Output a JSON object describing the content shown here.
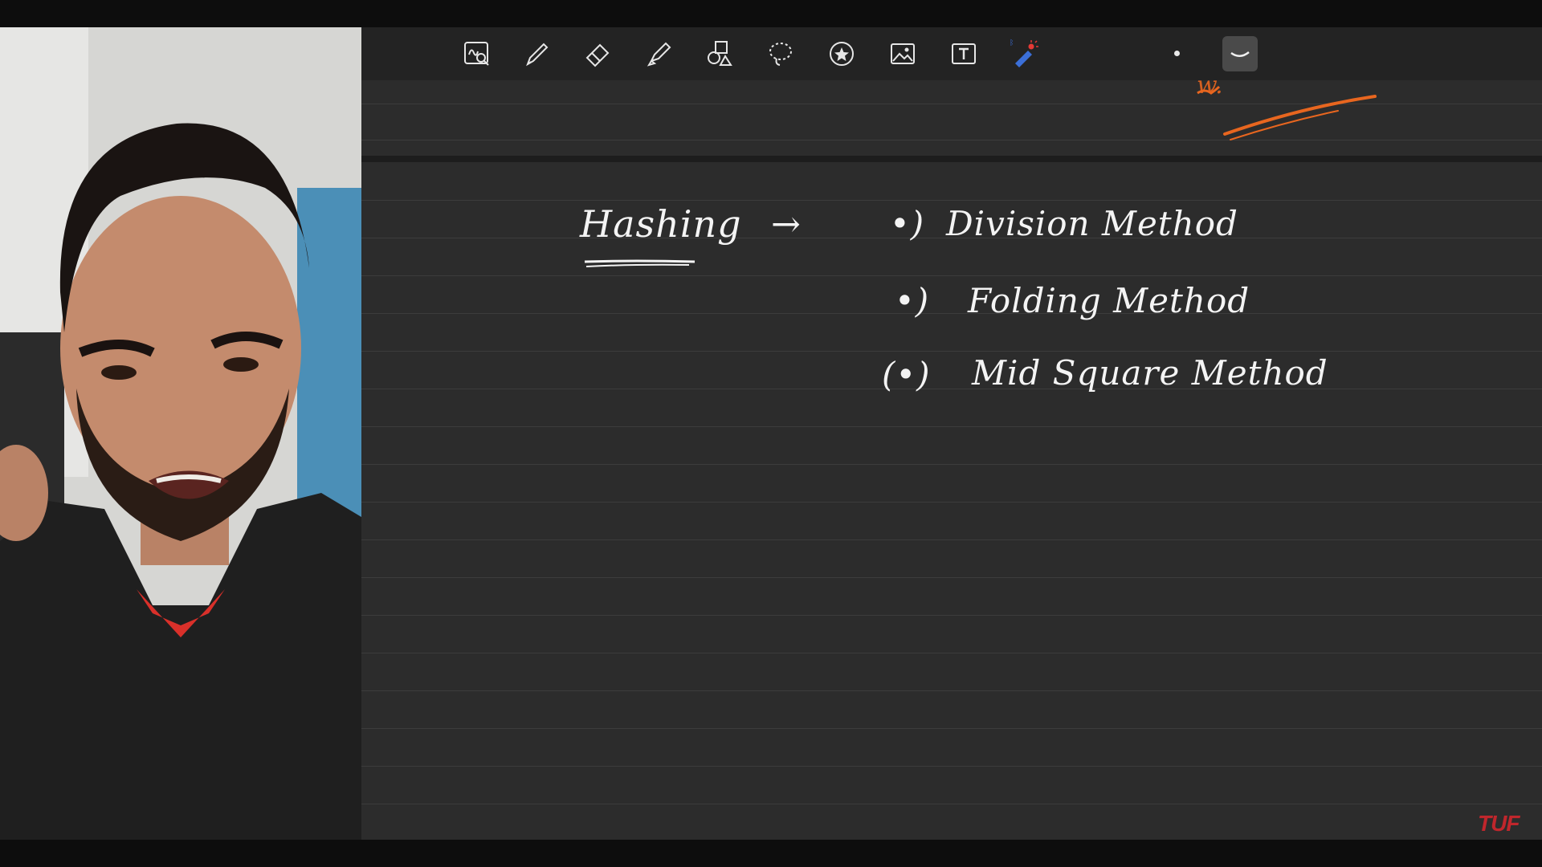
{
  "app": {
    "toolbar": {
      "tools": [
        {
          "name": "zoom-icon",
          "selected": false
        },
        {
          "name": "pen-icon",
          "selected": false
        },
        {
          "name": "eraser-icon",
          "selected": false
        },
        {
          "name": "highlighter-icon",
          "selected": false
        },
        {
          "name": "shapes-icon",
          "selected": false
        },
        {
          "name": "lasso-icon",
          "selected": false
        },
        {
          "name": "sticker-icon",
          "selected": false
        },
        {
          "name": "image-icon",
          "selected": false
        },
        {
          "name": "text-icon",
          "selected": false
        },
        {
          "name": "laser-pointer-icon",
          "selected": false
        },
        {
          "name": "stroke-style-icon",
          "selected": true
        }
      ],
      "pen_size": "small-dot"
    },
    "colors": {
      "ink": "#f4f4f4",
      "accent_ink": "#e8661f",
      "paper": "#2c2c2c",
      "laser_tip": "#e53935",
      "laser_body": "#3b6fd8"
    }
  },
  "notes": {
    "heading": "Hashing",
    "arrow": "→",
    "items": [
      {
        "bullet": "•)",
        "text": "Division Method"
      },
      {
        "bullet": "•)",
        "text": "Folding Method"
      },
      {
        "bullet": "(•)",
        "text": "Mid Square Method"
      }
    ],
    "top_fragment": "w."
  },
  "watermark": {
    "text": "TUF"
  }
}
